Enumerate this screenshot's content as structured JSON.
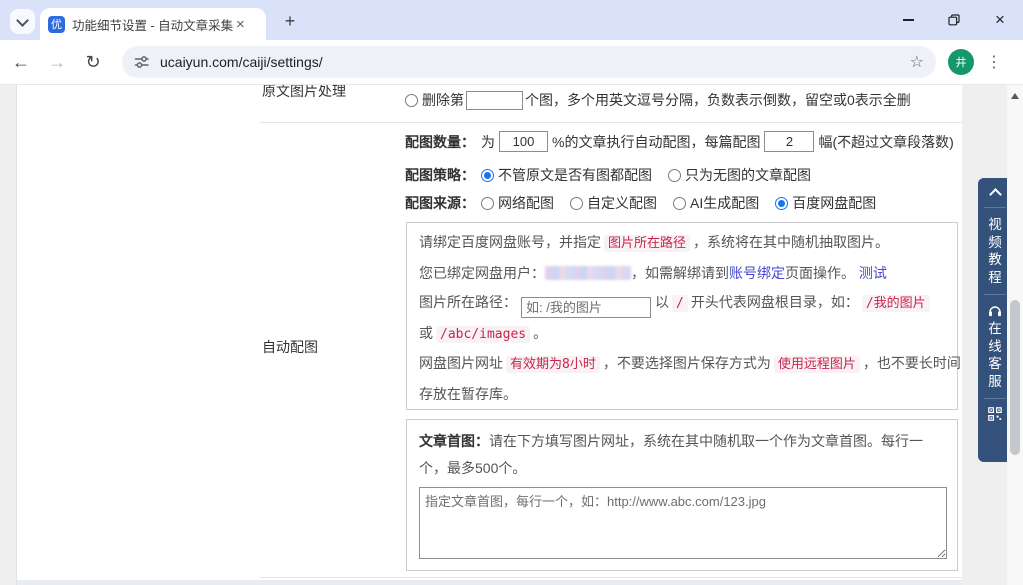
{
  "browser": {
    "tab_title": "功能细节设置 - 自动文章采集器",
    "url": "ucaiyun.com/caiji/settings/",
    "favicon_text": "优",
    "avatar_text": "井"
  },
  "icons": {
    "back": "←",
    "forward": "→",
    "reload": "↻",
    "star": "☆",
    "menu": "⋮",
    "new_tab": "+",
    "close_tab": "×",
    "close_window": "×"
  },
  "page": {
    "row_orig_image": {
      "label": "原文图片处理",
      "option_pre": "删除第",
      "input_value": "",
      "option_post": "个图，多个用英文逗号分隔，负数表示倒数，留空或0表示全删"
    },
    "auto_image_label": "自动配图",
    "image_count": {
      "label": "配图数量：",
      "t1": "为",
      "percent_value": "100",
      "t2": "%的文章执行自动配图，每篇配图",
      "count_value": "2",
      "t3": "幅(不超过文章段落数)"
    },
    "image_strategy": {
      "label": "配图策略：",
      "options": [
        {
          "label": "不管原文是否有图都配图",
          "selected": true
        },
        {
          "label": "只为无图的文章配图",
          "selected": false
        }
      ]
    },
    "image_source": {
      "label": "配图来源：",
      "options": [
        {
          "label": "网络配图",
          "selected": false
        },
        {
          "label": "自定义配图",
          "selected": false
        },
        {
          "label": "AI生成配图",
          "selected": false
        },
        {
          "label": "百度网盘配图",
          "selected": true
        }
      ]
    },
    "netdisk_box": {
      "line1": {
        "t1": "请绑定百度网盘账号，并指定",
        "code1": "图片所在路径",
        "t2": "，系统将在其中随机抽取图片。"
      },
      "line2": {
        "t1": "您已绑定网盘用户：",
        "t2": "，如需解绑请到",
        "link1": "账号绑定",
        "t3": "页面操作。",
        "link2": "测试"
      },
      "line3": {
        "t1": "图片所在路径：",
        "input_placeholder": "如: /我的图片",
        "t2": "以",
        "code1": "/",
        "t3": "开头代表网盘根目录，如：",
        "code2": "/我的图片"
      },
      "line4": {
        "t1": "或",
        "code1": "/abc/images",
        "t2": "。"
      },
      "line5": {
        "t1": "网盘图片网址",
        "code1": "有效期为8小时",
        "t2": "，不要选择图片保存方式为",
        "code2": "使用远程图片",
        "t3": "，也不要长时间"
      },
      "line6": "存放在暂存库。"
    },
    "first_image_box": {
      "label": "文章首图：",
      "text": "请在下方填写图片网址，系统在其中随机取一个作为文章首图。每行一个，最多500个。",
      "textarea_placeholder": "指定文章首图，每行一个，如：http://www.abc.com/123.jpg"
    }
  },
  "side_widget": {
    "video_tutorial": "视频教程",
    "online_service": "在线客服"
  },
  "colors": {
    "accent_blue": "#1a73e8",
    "link": "#4747d1",
    "code_red": "#c7254e",
    "code_bg": "#f9f2f4",
    "widget_bg": "#33517b",
    "avatar_green": "#15976d",
    "titlebar": "#d9e2f8"
  }
}
